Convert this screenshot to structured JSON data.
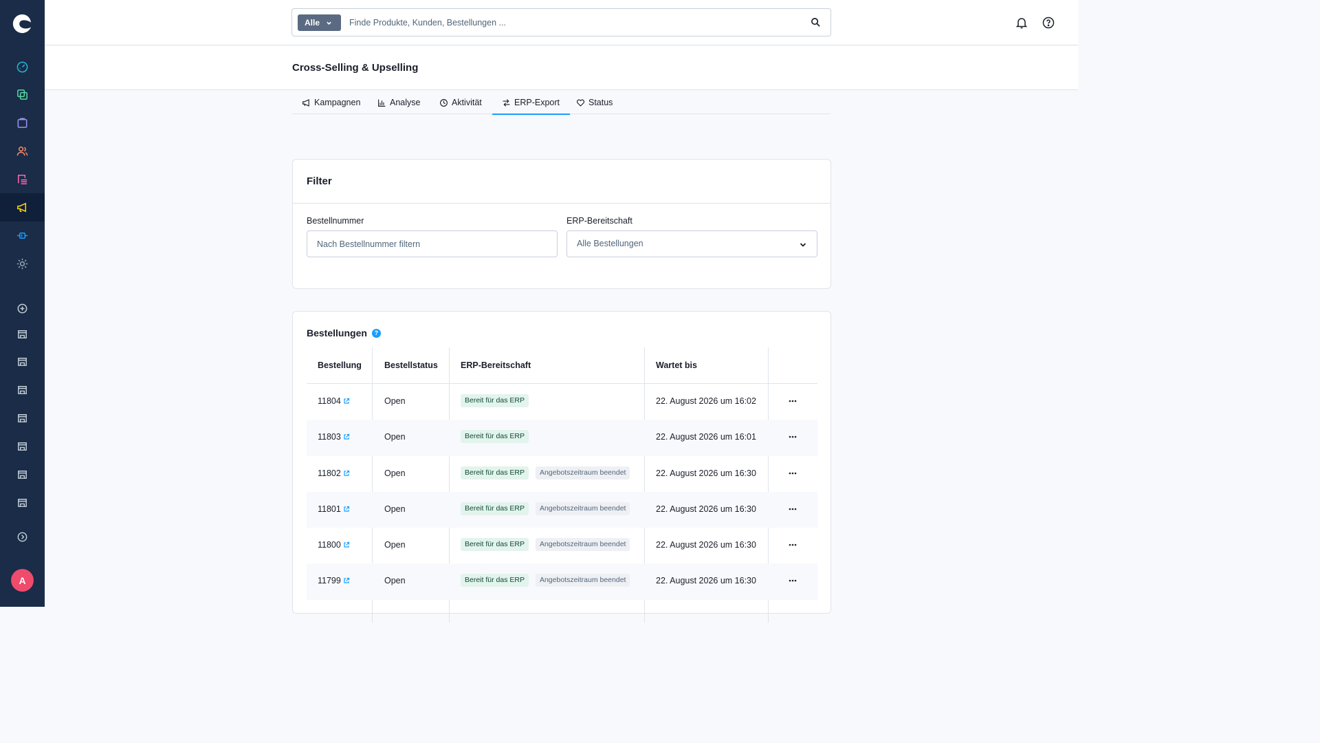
{
  "search": {
    "type_label": "Alle",
    "placeholder": "Finde Produkte, Kunden, Bestellungen ..."
  },
  "page": {
    "title": "Cross-Selling & Upselling"
  },
  "tabs": [
    {
      "label": "Kampagnen",
      "icon": "megaphone-icon"
    },
    {
      "label": "Analyse",
      "icon": "bar-chart-icon"
    },
    {
      "label": "Aktivität",
      "icon": "clock-icon"
    },
    {
      "label": "ERP-Export",
      "icon": "arrows-exchange-icon",
      "active": true
    },
    {
      "label": "Status",
      "icon": "heart-icon"
    }
  ],
  "filter": {
    "title": "Filter",
    "order_number_label": "Bestellnummer",
    "order_number_placeholder": "Nach Bestellnummer filtern",
    "erp_label": "ERP-Bereitschaft",
    "erp_selected": "Alle Bestellungen"
  },
  "orders": {
    "title": "Bestellungen",
    "help": "?",
    "columns": [
      "Bestellung",
      "Bestellstatus",
      "ERP-Bereitschaft",
      "Wartet bis"
    ],
    "rows": [
      {
        "number": "11804",
        "status": "Open",
        "erp": "Bereit für das ERP",
        "tag": "",
        "waits_until": "22. August 2026 um 16:02"
      },
      {
        "number": "11803",
        "status": "Open",
        "erp": "Bereit für das ERP",
        "tag": "",
        "waits_until": "22. August 2026 um 16:01"
      },
      {
        "number": "11802",
        "status": "Open",
        "erp": "Bereit für das ERP",
        "tag": "Angebotszeitraum beendet",
        "waits_until": "22. August 2026 um 16:30"
      },
      {
        "number": "11801",
        "status": "Open",
        "erp": "Bereit für das ERP",
        "tag": "Angebotszeitraum beendet",
        "waits_until": "22. August 2026 um 16:30"
      },
      {
        "number": "11800",
        "status": "Open",
        "erp": "Bereit für das ERP",
        "tag": "Angebotszeitraum beendet",
        "waits_until": "22. August 2026 um 16:30"
      },
      {
        "number": "11799",
        "status": "Open",
        "erp": "Bereit für das ERP",
        "tag": "Angebotszeitraum beendet",
        "waits_until": "22. August 2026 um 16:30"
      }
    ]
  },
  "user": {
    "avatar_initial": "A"
  },
  "colors": {
    "sidebar": "#1a2c47",
    "accent": "#189eff",
    "badge_green_bg": "#e3f3ed",
    "avatar": "#ef4b6c"
  }
}
